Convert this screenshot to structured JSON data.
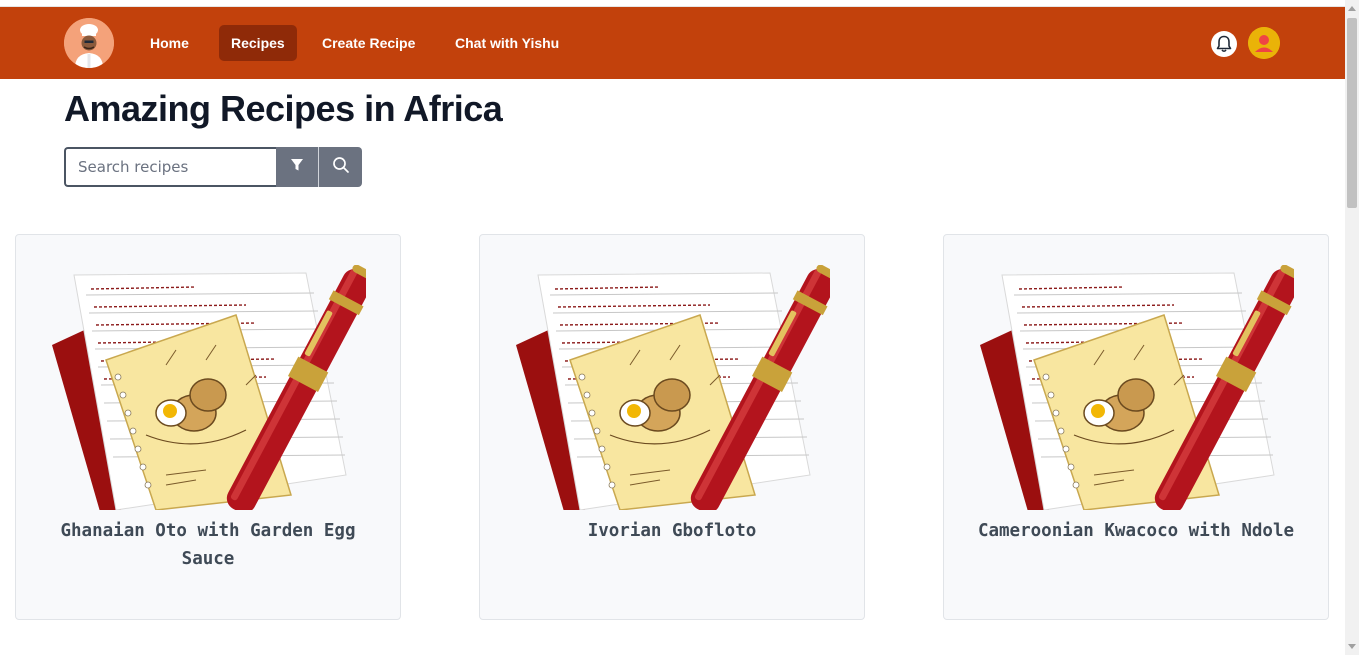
{
  "nav": {
    "logo_icon": "chef-avatar-icon",
    "links": [
      {
        "label": "Home",
        "active": false
      },
      {
        "label": "Recipes",
        "active": true
      },
      {
        "label": "Create Recipe",
        "active": false
      },
      {
        "label": "Chat with Yishu",
        "active": false
      }
    ],
    "notification_icon": "bell-icon",
    "profile_icon": "user-avatar-icon"
  },
  "page": {
    "title": "Amazing Recipes in Africa"
  },
  "search": {
    "placeholder": "Search recipes",
    "value": "",
    "filter_icon": "filter-icon",
    "search_icon": "search-icon"
  },
  "recipes": [
    {
      "title": "Ghanaian Oto with Garden Egg Sauce",
      "image": "recipe-notebook-icon"
    },
    {
      "title": "Ivorian Gbofloto",
      "image": "recipe-notebook-icon"
    },
    {
      "title": "Cameroonian Kwacoco with Ndole",
      "image": "recipe-notebook-icon"
    }
  ],
  "colors": {
    "brand": "#c2410c",
    "active_nav": "#8f2a08",
    "title": "#111827",
    "card_bg": "#f8f9fb",
    "button": "#6b7280"
  }
}
